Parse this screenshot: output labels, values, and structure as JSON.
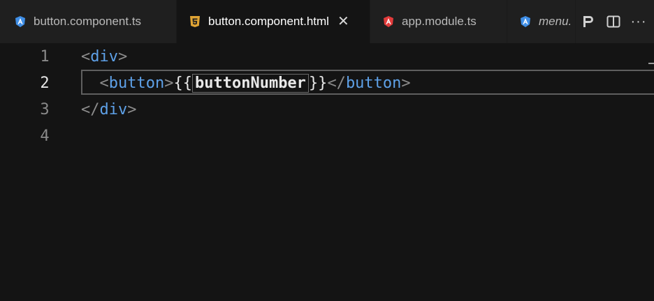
{
  "tabs": [
    {
      "label": "button.component.ts",
      "icon": "angular-component-icon",
      "active": false,
      "italic": false
    },
    {
      "label": "button.component.html",
      "icon": "html5-icon",
      "active": true,
      "italic": false,
      "close": "✕"
    },
    {
      "label": "app.module.ts",
      "icon": "angular-module-icon",
      "active": false,
      "italic": false
    },
    {
      "label": "menu.",
      "icon": "angular-component-icon",
      "active": false,
      "italic": true
    }
  ],
  "actions": {
    "more": "···"
  },
  "editor": {
    "lines": [
      {
        "number": "1",
        "open": "<",
        "tag": "div",
        "close": ">"
      },
      {
        "number": "2",
        "open": "<",
        "tag": "button",
        "close": ">",
        "brace_open": "{{",
        "expression": "buttonNumber",
        "brace_close": "}}",
        "end_open": "</",
        "end_tag": "button",
        "end_close": ">"
      },
      {
        "number": "3",
        "open": "</",
        "tag": "div",
        "close": ">"
      },
      {
        "number": "4"
      }
    ]
  },
  "colors": {
    "tag": "#5ea1e8",
    "angular": "#3f8ee6",
    "html5": "#e0a434",
    "angular_module": "#e23b3b",
    "background": "#141414",
    "tabbar": "#1f1f1f"
  }
}
